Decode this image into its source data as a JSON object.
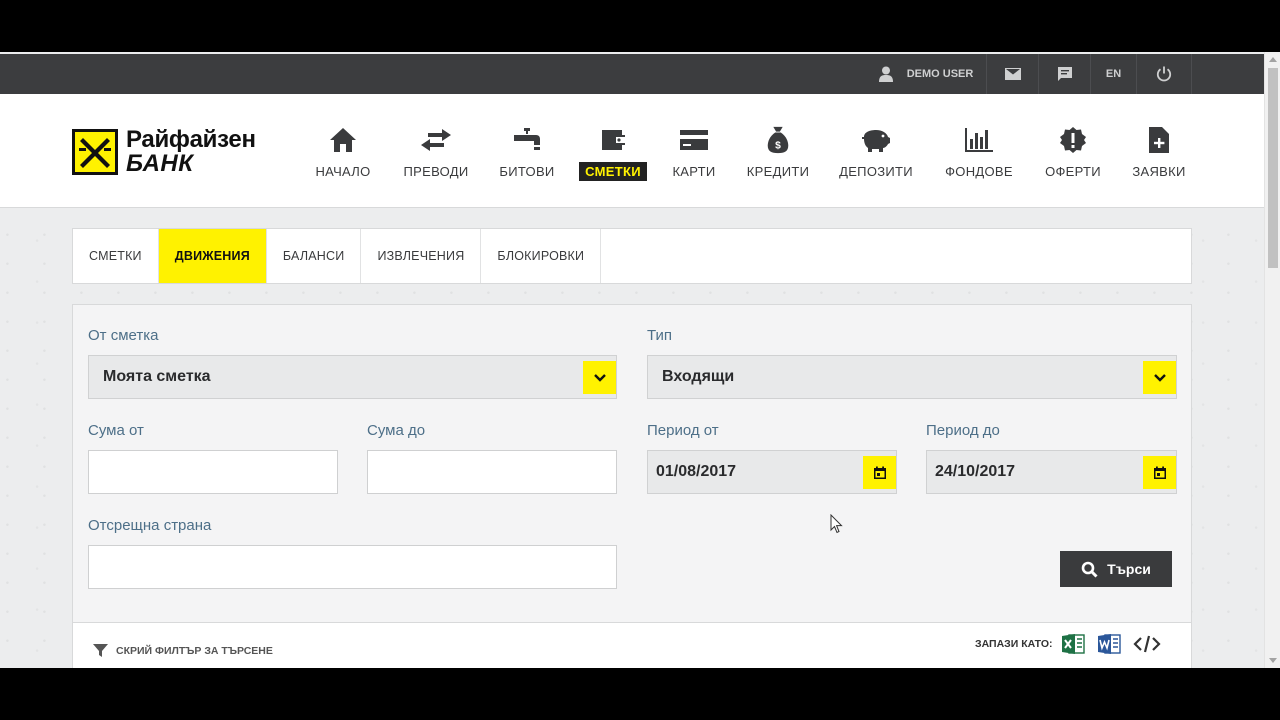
{
  "topbar": {
    "user_label": "DEMO USER",
    "lang_label": "EN"
  },
  "brand": {
    "name": "Райфайзен",
    "bank": "БАНК",
    "accent": "#fff200"
  },
  "nav": {
    "home": "НАЧАЛО",
    "transfers": "ПРЕВОДИ",
    "utilities": "БИТОВИ",
    "accounts": "СМЕТКИ",
    "cards": "КАРТИ",
    "loans": "КРЕДИТИ",
    "deposits": "ДЕПОЗИТИ",
    "funds": "ФОНДОВЕ",
    "offers": "ОФЕРТИ",
    "requests": "ЗАЯВКИ",
    "active": "СМЕТКИ"
  },
  "tabs": {
    "accounts": "СМЕТКИ",
    "movements": "ДВИЖЕНИЯ",
    "balances": "БАЛАНСИ",
    "statements": "ИЗВЛЕЧЕНИЯ",
    "blocks": "БЛОКИРОВКИ",
    "active": "ДВИЖЕНИЯ"
  },
  "filter": {
    "from_account_label": "От сметка",
    "from_account_value": "Моята сметка",
    "type_label": "Тип",
    "type_value": "Входящи",
    "amount_from_label": "Сума от",
    "amount_from_value": "",
    "amount_to_label": "Сума до",
    "amount_to_value": "",
    "period_from_label": "Период от",
    "period_from_value": "01/08/2017",
    "period_to_label": "Период до",
    "period_to_value": "24/10/2017",
    "counterparty_label": "Отсрещна страна",
    "counterparty_value": "",
    "search_button": "Търси"
  },
  "footer": {
    "hide_filter": "СКРИЙ ФИЛТЪР ЗА ТЪРСЕНЕ",
    "save_as": "ЗАПАЗИ КАТО:"
  }
}
